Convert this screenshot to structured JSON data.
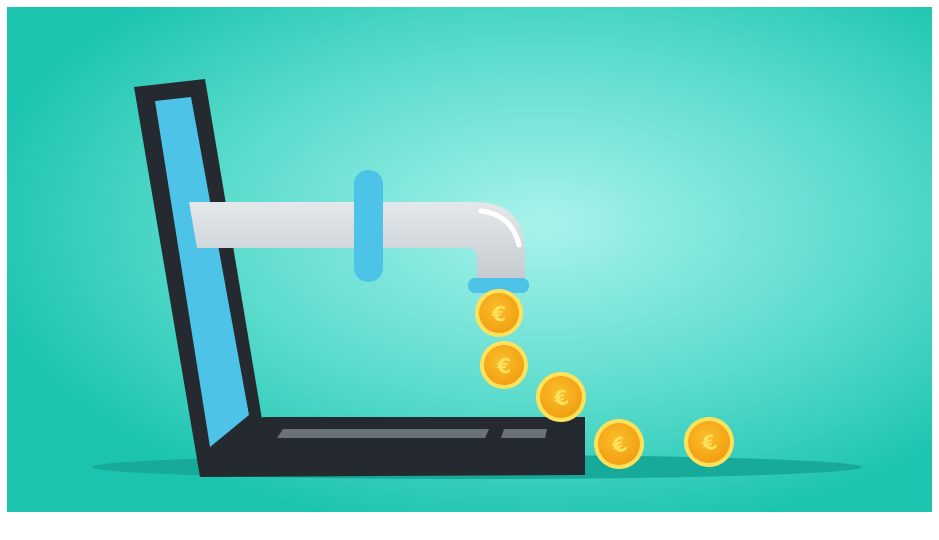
{
  "illustration": {
    "subject": "",
    "colors": {
      "background_center": "#a8f3ec",
      "background_edge": "#1cc4b0",
      "shadow": "#17a99a",
      "laptop_body": "#252a31",
      "laptop_screen": "#4ec3e8",
      "keyboard_keys": "#6b7179",
      "pipe": "#cfd4d8",
      "pipe_highlight": "#ffffff",
      "pipe_band": "#4ec3e8",
      "coin_fill": "#f7b21e",
      "coin_rim": "#fde25c",
      "coin_symbol": "#fde25c"
    },
    "coin_symbol": "€",
    "coin_count": 5
  }
}
